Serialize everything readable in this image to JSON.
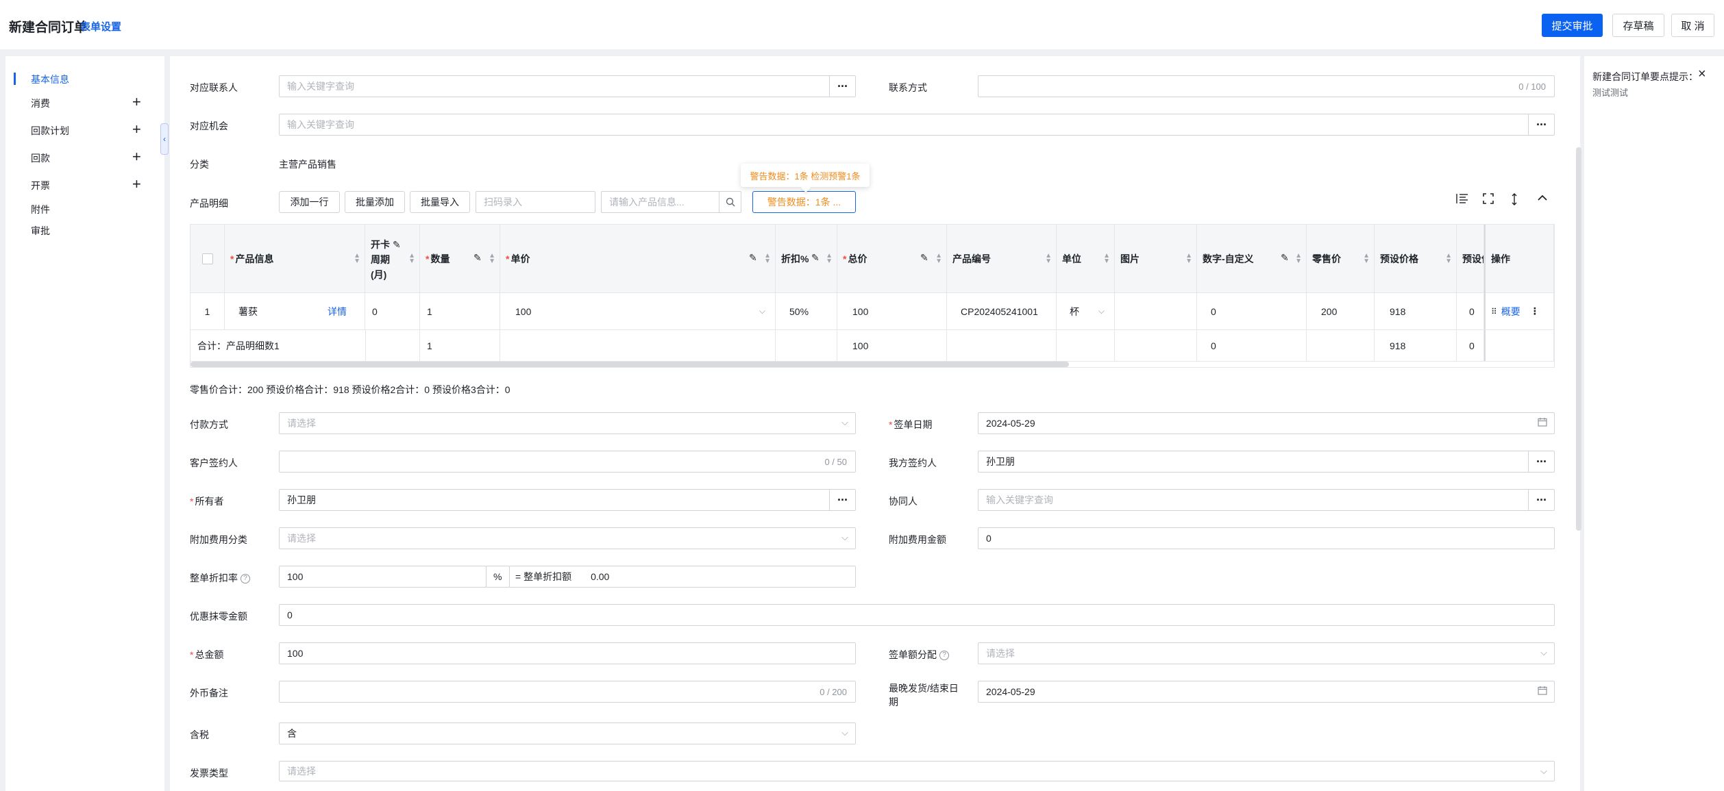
{
  "header": {
    "title": "新建合同订单",
    "settings_link": "表单设置",
    "submit_label": "提交审批",
    "draft_label": "存草稿",
    "cancel_label": "取 消"
  },
  "sidebar": {
    "items": [
      {
        "label": "基本信息",
        "active": true,
        "plus": false
      },
      {
        "label": "消费",
        "plus": true
      },
      {
        "label": "回款计划",
        "plus": true
      },
      {
        "label": "回款",
        "plus": true
      },
      {
        "label": "开票",
        "plus": true
      },
      {
        "label": "附件",
        "plus": false
      },
      {
        "label": "审批",
        "plus": false
      }
    ],
    "collapse_icon": "chevron-left-icon"
  },
  "form": {
    "contact": {
      "label": "对应联系人",
      "placeholder": "输入关键字查询"
    },
    "contact_method": {
      "label": "联系方式",
      "counter": "0 / 100"
    },
    "opportunity": {
      "label": "对应机会",
      "placeholder": "输入关键字查询"
    },
    "category": {
      "label": "分类",
      "value": "主营产品销售"
    },
    "product_detail": {
      "label": "产品明细",
      "add_row": "添加一行",
      "batch_add": "批量添加",
      "batch_import": "批量导入",
      "scan_placeholder": "扫码录入",
      "search_placeholder": "请输入产品信息...",
      "warning_button": "警告数据：1条 ...",
      "warning_tooltip": "警告数据：1条 检测预警1条"
    },
    "payment_method": {
      "label": "付款方式",
      "placeholder": "请选择"
    },
    "sign_date": {
      "label": "签单日期",
      "value": "2024-05-29"
    },
    "customer_signer": {
      "label": "客户签约人",
      "counter": "0 / 50"
    },
    "our_signer": {
      "label": "我方签约人",
      "value": "孙卫朋"
    },
    "owner": {
      "label": "所有者",
      "value": "孙卫朋"
    },
    "collaborator": {
      "label": "协同人",
      "placeholder": "输入关键字查询"
    },
    "extra_fee_category": {
      "label": "附加费用分类",
      "placeholder": "请选择"
    },
    "extra_fee_amount": {
      "label": "附加费用金额",
      "value": "0"
    },
    "discount_rate": {
      "label": "整单折扣率",
      "value": "100",
      "unit": "%",
      "discount_amount_label": "= 整单折扣额",
      "discount_amount": "0.00"
    },
    "rounding": {
      "label": "优惠抹零金额",
      "value": "0"
    },
    "total_amount": {
      "label": "总金额",
      "value": "100"
    },
    "sign_amount_allocation": {
      "label": "签单额分配",
      "placeholder": "请选择"
    },
    "foreign_currency_note": {
      "label": "外币备注",
      "counter": "0 / 200"
    },
    "latest_ship_date": {
      "label": "最晚发货/结束日期",
      "value": "2024-05-29"
    },
    "tax_included": {
      "label": "含税",
      "value": "含"
    },
    "invoice_type": {
      "label": "发票类型",
      "placeholder": "请选择"
    }
  },
  "table": {
    "headers": {
      "product_info": "产品信息",
      "open_card_period": "开卡周期(月)",
      "quantity": "数量",
      "unit_price": "单价",
      "discount": "折扣%",
      "total_price": "总价",
      "product_code": "产品编号",
      "unit": "单位",
      "image": "图片",
      "number_custom": "数字-自定义",
      "retail_price": "零售价",
      "preset_price": "预设价格",
      "preset_price_2": "预设价",
      "operation": "操作"
    },
    "row": {
      "index": "1",
      "product": "薯获",
      "detail_link": "详情",
      "open_card_period": "0",
      "quantity": "1",
      "unit_price": "100",
      "discount": "50%",
      "total_price": "100",
      "product_code": "CP202405241001",
      "unit": "杯",
      "number_custom": "0",
      "retail_price": "200",
      "preset_price": "918",
      "preset_price_2": "0",
      "op_link": "概要"
    },
    "total_row": {
      "label": "合计：产品明细数1",
      "quantity": "1",
      "total_price": "100",
      "number_custom": "0",
      "preset_price": "918",
      "preset_price_2": "0"
    }
  },
  "summary_text": "零售价合计：200  预设价格合计：918  预设价格2合计：0  预设价格3合计：0",
  "right_panel": {
    "title": "新建合同订单要点提示：",
    "body": "测试测试"
  }
}
